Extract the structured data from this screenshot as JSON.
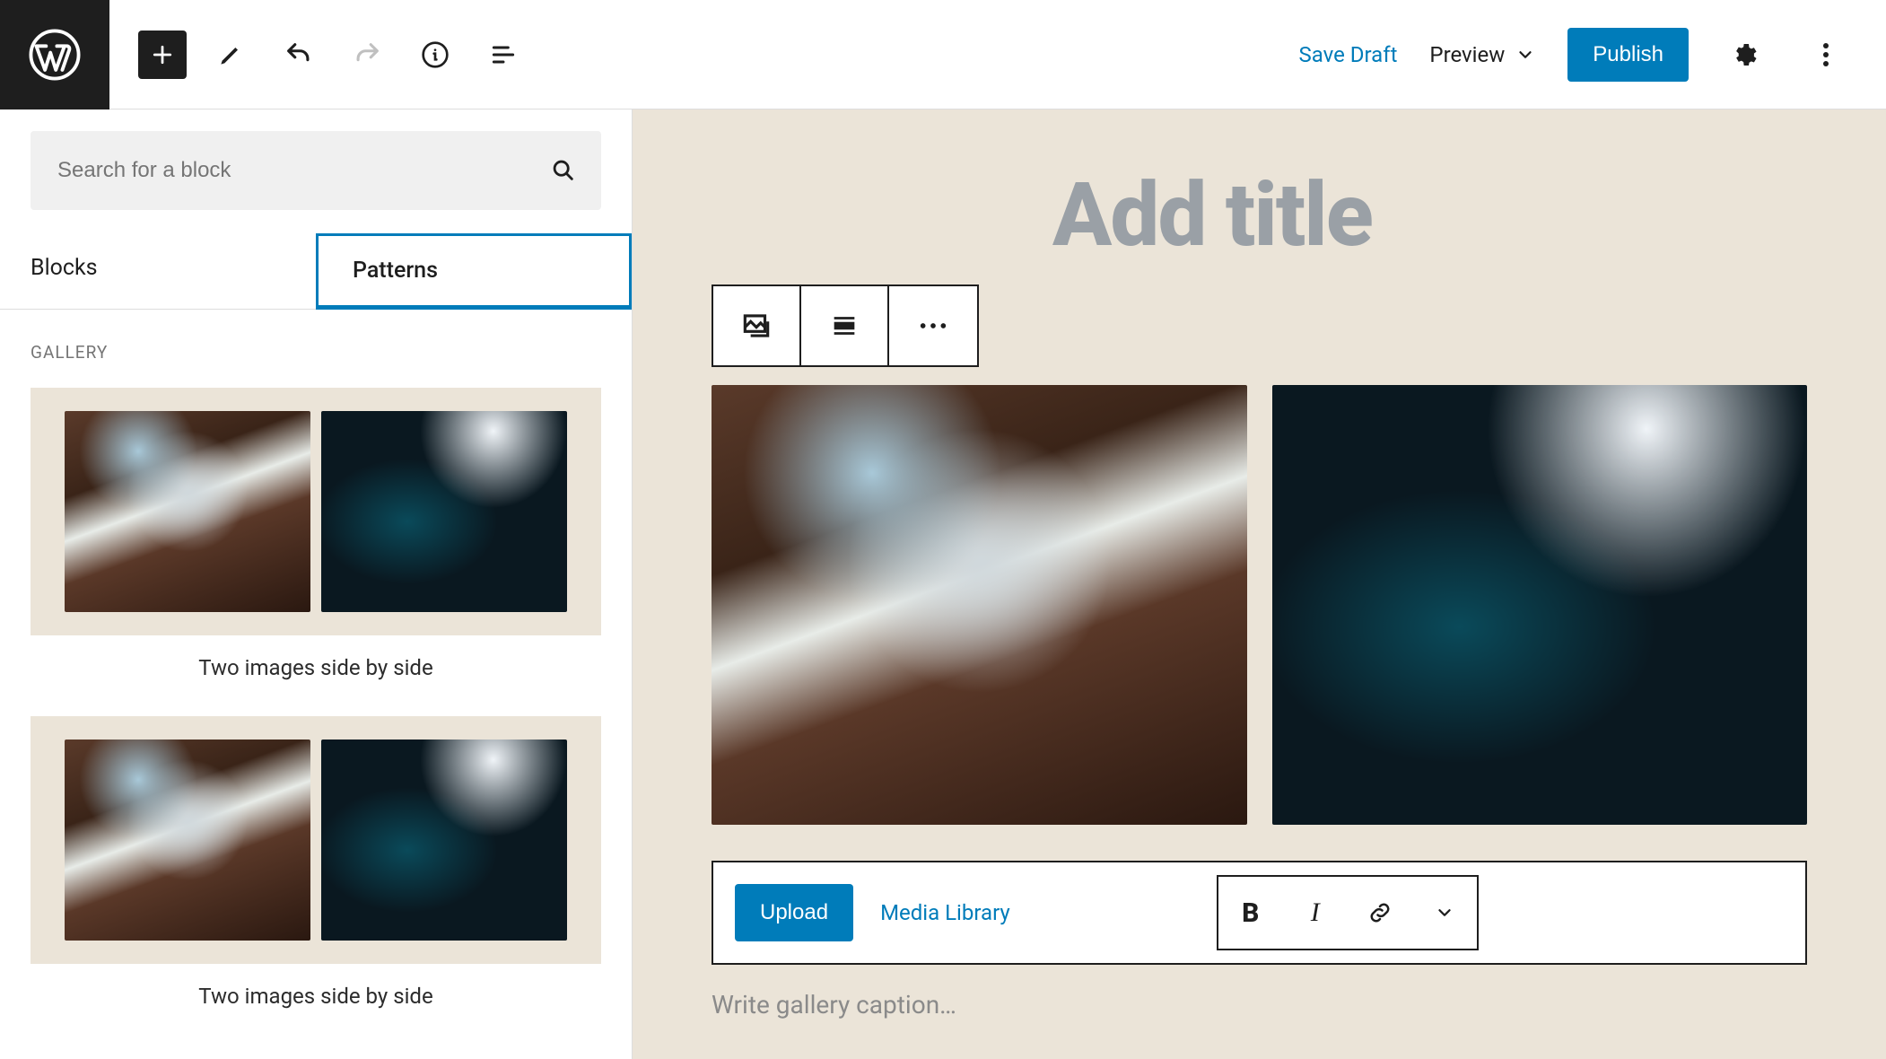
{
  "colors": {
    "accent": "#007cba"
  },
  "topbar": {
    "save_draft": "Save Draft",
    "preview": "Preview",
    "publish": "Publish"
  },
  "inserter": {
    "search_placeholder": "Search for a block",
    "tabs": {
      "blocks": "Blocks",
      "patterns": "Patterns",
      "active": "patterns"
    },
    "category": "Gallery",
    "patterns": [
      {
        "label": "Two images side by side"
      },
      {
        "label": "Two images side by side"
      }
    ]
  },
  "editor": {
    "title_placeholder": "Add title",
    "media": {
      "upload": "Upload",
      "library": "Media Library"
    },
    "caption_placeholder": "Write gallery caption…"
  }
}
